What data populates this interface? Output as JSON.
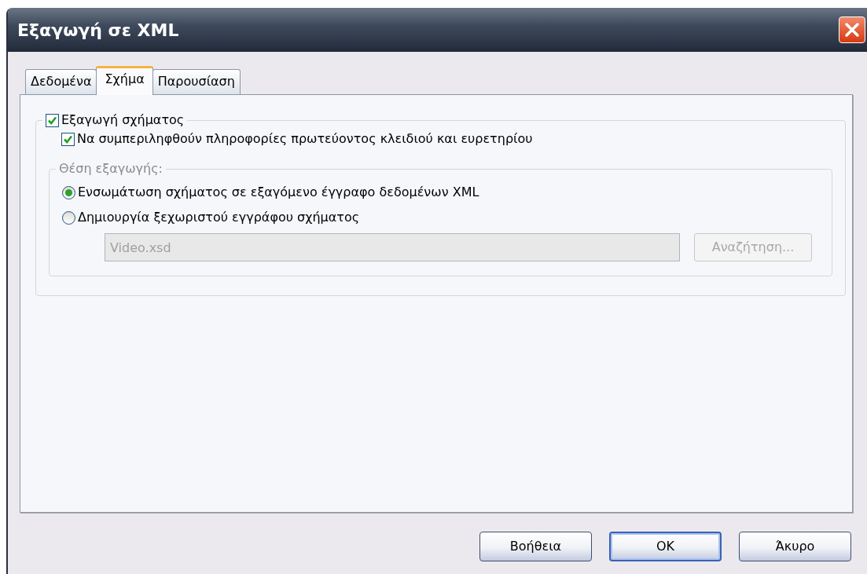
{
  "window": {
    "title": "Εξαγωγή σε XML"
  },
  "tabs": [
    {
      "label": "Δεδομένα",
      "selected": false
    },
    {
      "label": "Σχήμα",
      "selected": true
    },
    {
      "label": "Παρουσίαση",
      "selected": false
    }
  ],
  "export_schema": {
    "label": "Εξαγωγή σχήματος",
    "checked": true
  },
  "include_keys": {
    "label": "Να συμπεριληφθούν πληροφορίες πρωτεύοντος κλειδιού και ευρετηρίου",
    "checked": true
  },
  "export_location": {
    "label": "Θέση εξαγωγής:",
    "disabled": true,
    "options": [
      {
        "label": "Ενσωμάτωση σχήματος σε εξαγόμενο έγγραφο δεδομένων XML",
        "selected": true
      },
      {
        "label": "Δημιουργία ξεχωριστού εγγράφου σχήματος",
        "selected": false
      }
    ],
    "file_field": {
      "value": "Video.xsd",
      "disabled": true
    },
    "browse_button": {
      "label": "Αναζήτηση...",
      "disabled": true
    }
  },
  "buttons": [
    {
      "label": "Βοήθεια",
      "default": false
    },
    {
      "label": "OK",
      "default": true
    },
    {
      "label": "Άκυρο",
      "default": false
    }
  ]
}
